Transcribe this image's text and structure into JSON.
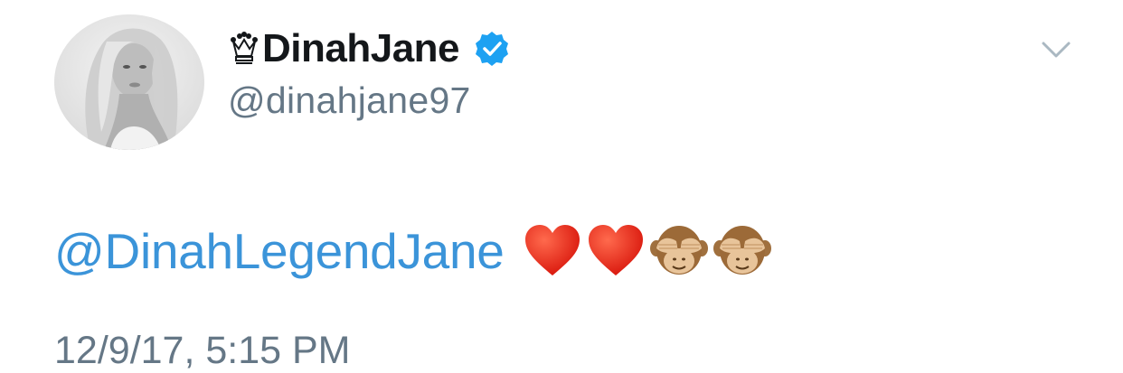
{
  "tweet": {
    "author": {
      "name": "DinahJane",
      "handle": "@dinahjane97",
      "verified": true,
      "name_prefix_icon": "crown-icon"
    },
    "text": {
      "mention": "@DinahLegendJane",
      "emojis": [
        "red-heart-icon",
        "red-heart-icon",
        "see-no-evil-monkey-icon",
        "see-no-evil-monkey-icon"
      ]
    },
    "timestamp": "12/9/17, 5:15 PM",
    "menu_icon": "chevron-down-icon"
  },
  "colors": {
    "name": "#14171a",
    "secondary": "#657786",
    "link": "#3b94d9",
    "verified_badge": "#1da1f2"
  }
}
